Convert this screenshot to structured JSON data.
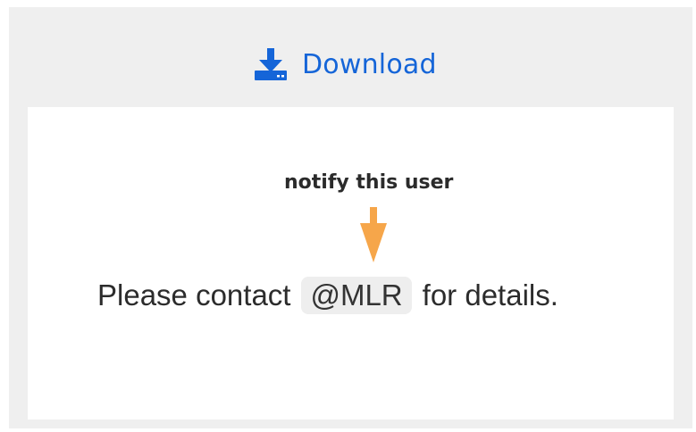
{
  "download": {
    "label": "Download",
    "icon": "download-icon",
    "color": "#1565d8"
  },
  "preview": {
    "annotation": "notify this user",
    "arrow_color": "#f6a64a",
    "message_before": "Please contact",
    "mention": "@MLR",
    "message_after": "for details."
  }
}
